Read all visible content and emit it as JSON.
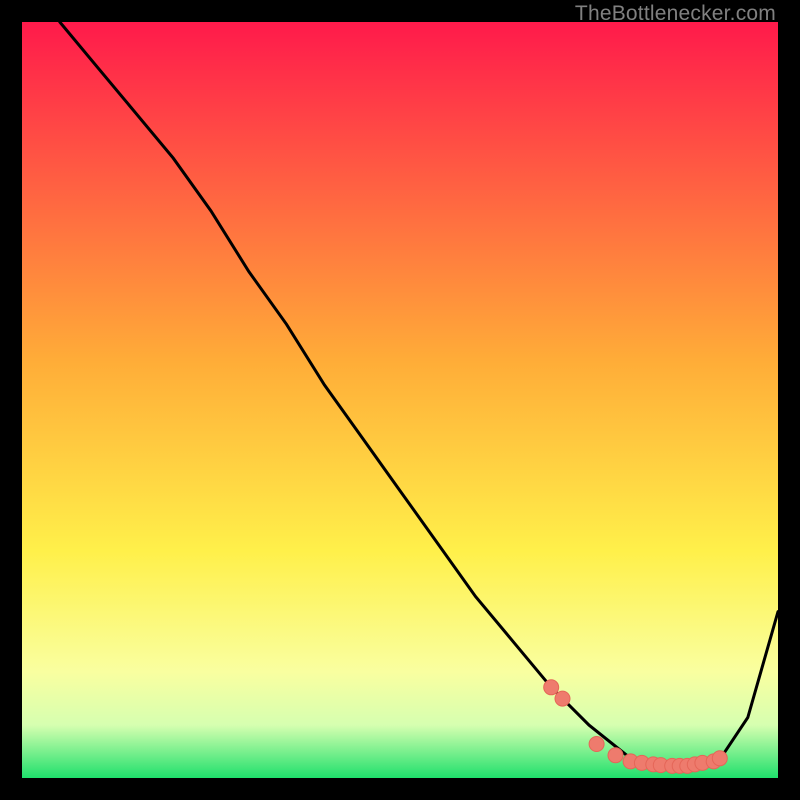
{
  "watermark": "TheBottlenecker.com",
  "colors": {
    "curve": "#000000",
    "dot_fill": "#ee7b6d",
    "dot_stroke": "#e56658",
    "grad_top": "#ff1a4b",
    "grad_mid_hi": "#ffad38",
    "grad_mid_lo": "#fff04a",
    "grad_low1": "#f9ffa0",
    "grad_low2": "#d6ffb0",
    "grad_bottom": "#1fe06c"
  },
  "chart_data": {
    "type": "line",
    "title": "",
    "xlabel": "",
    "ylabel": "",
    "xlim": [
      0,
      100
    ],
    "ylim": [
      0,
      100
    ],
    "legend": false,
    "grid": false,
    "curve": {
      "name": "bottleneck-curve",
      "x": [
        5,
        10,
        15,
        20,
        25,
        30,
        35,
        40,
        45,
        50,
        55,
        60,
        65,
        70,
        75,
        80,
        82,
        85,
        88,
        92,
        96,
        100
      ],
      "y": [
        100,
        94,
        88,
        82,
        75,
        67,
        60,
        52,
        45,
        38,
        31,
        24,
        18,
        12,
        7,
        3,
        2,
        1.5,
        1.5,
        2,
        8,
        22
      ]
    },
    "dots": {
      "name": "highlight-dots",
      "x": [
        70,
        71.5,
        76,
        78.5,
        80.5,
        82,
        83.5,
        84.5,
        86,
        87,
        88,
        89,
        90,
        91.5,
        92.3
      ],
      "y": [
        12,
        10.5,
        4.5,
        3,
        2.2,
        2,
        1.8,
        1.7,
        1.6,
        1.6,
        1.6,
        1.8,
        2,
        2.2,
        2.6
      ]
    }
  }
}
